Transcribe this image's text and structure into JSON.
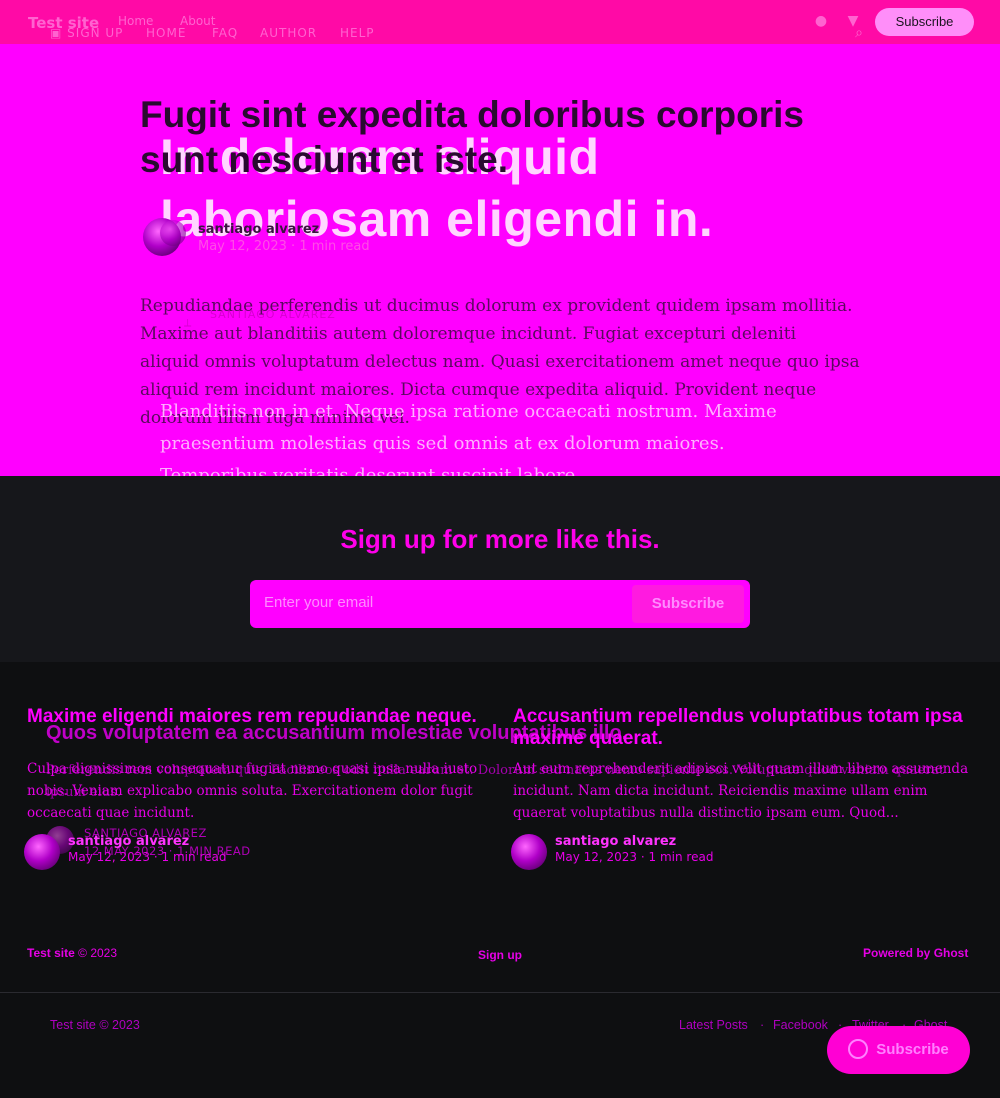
{
  "header": {
    "logo": "Test site",
    "nav_primary": [
      "Home",
      "About"
    ],
    "nav_secondary": [
      "SIGN UP",
      "HOME",
      "FAQ",
      "AUTHOR",
      "HELP"
    ],
    "subscribe_label": "Subscribe",
    "icons": [
      "facebook-icon",
      "twitter-icon",
      "search-icon",
      "mail-icon",
      "rss-icon"
    ]
  },
  "post": {
    "title": "Fugit sint expedita doloribus corporis sunt nesciunt et iste.",
    "author": "santiago alvarez",
    "date": "May 12, 2023",
    "read_time": "1 min read",
    "body": "Repudiandae perferendis ut ducimus dolorum ex provident quidem ipsam mollitia. Maxime aut blanditiis autem doloremque incidunt. Fugiat excepturi deleniti aliquid omnis voluptatum delectus nam. Quasi exercitationem amet neque quo ipsa aliquid rem incidunt maiores. Dicta cumque expedita aliquid. Provident neque dolorum illum fuga minima vel."
  },
  "overlay": {
    "title": "In dolorem aliquid laboriosam eligendi in.",
    "author": "SANTIAGO ALVAREZ",
    "body": "Blanditiis non in et. Neque ipsa ratione occaecati nostrum. Maxime praesentium molestias quis sed omnis at ex dolorum maiores. Temporibus veritatis deserunt suscipit labore."
  },
  "floating_subscribe": "Subscribe",
  "signup": {
    "title": "Sign up for more like this.",
    "placeholder": "Enter your email",
    "button": "Subscribe"
  },
  "related": [
    {
      "title": "Maxime eligendi maiores rem repudiandae neque.",
      "excerpt": "Culpa dignissimos consequatur fugiat nemo quasi ipsa nulla iusto nobis. Veniam explicabo omnis soluta. Exercitationem dolor fugit occaecati quae incidunt.",
      "author": "santiago alvarez",
      "date": "May 12, 2023",
      "read_time": "1 min read"
    },
    {
      "title": "Accusantium repellendus voluptatibus totam ipsa maxime quaerat.",
      "excerpt": "Aut eum reprehenderit adipisci velit quam illum libero assumenda incidunt. Nam dicta incidunt. Reiciendis maxime ullam enim quaerat voluptatibus nulla distinctio ipsam eum. Quod...",
      "author": "santiago alvarez",
      "date": "May 12, 2023",
      "read_time": "1 min read"
    }
  ],
  "overlay_related": {
    "title": "Quos voluptatem ea accusantium molestiae voluptatibus illo.",
    "excerpt": "Perferendis rem voluptatem quis. Facilis eos odit nulla earum et. Dolorum sed natus nemo sapiente eos. Voluptate quod veniam quaerat ipsum eius.",
    "author": "SANTIAGO ALVAREZ",
    "meta": "12 MAY 2023 · 1 MIN READ"
  },
  "footer_primary": {
    "site": "Test site",
    "copyright": "© 2023",
    "signup": "Sign up",
    "powered": "Powered by Ghost"
  },
  "footer_secondary": {
    "copyright": "Test site © 2023",
    "links": [
      "Latest Posts",
      "Facebook",
      "Twitter",
      "Ghost"
    ]
  }
}
